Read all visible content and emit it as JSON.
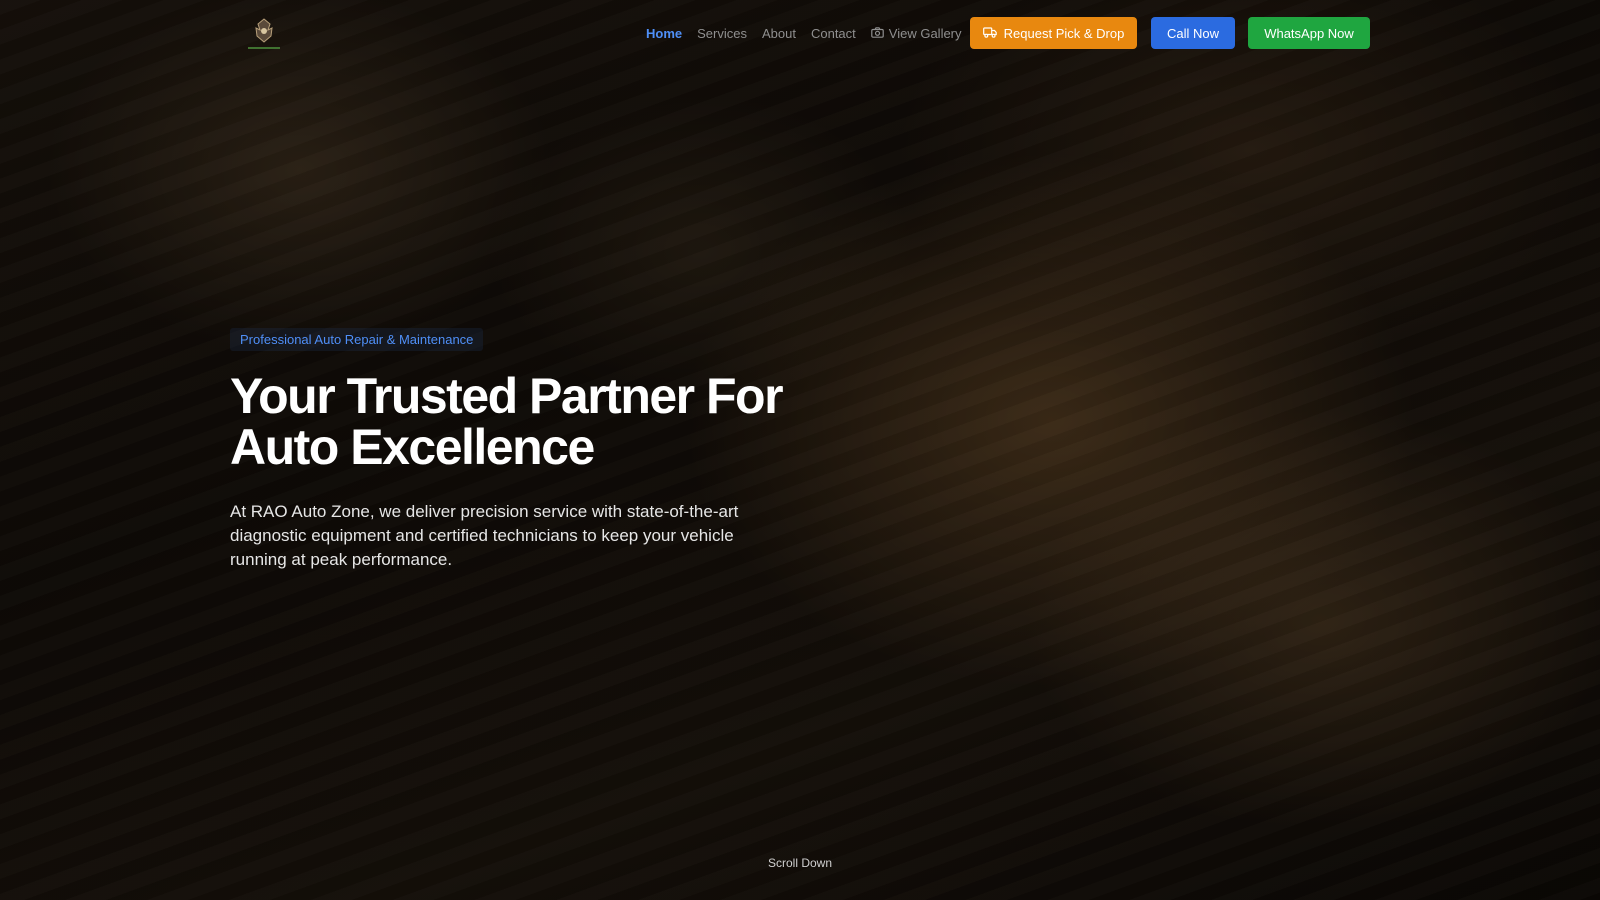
{
  "brand": {
    "logo_icon": "crest-logo-icon"
  },
  "nav": {
    "items": [
      {
        "label": "Home",
        "active": true
      },
      {
        "label": "Services",
        "active": false
      },
      {
        "label": "About",
        "active": false
      },
      {
        "label": "Contact",
        "active": false
      },
      {
        "label": "View Gallery",
        "active": false,
        "icon": "camera-icon"
      }
    ]
  },
  "actions": {
    "pickup": {
      "label": "Request Pick & Drop",
      "icon": "truck-icon",
      "color": "#e8880f"
    },
    "call": {
      "label": "Call Now",
      "color": "#2b6be0"
    },
    "whatsapp": {
      "label": "WhatsApp Now",
      "color": "#1fa640"
    }
  },
  "hero": {
    "tagline": "Professional Auto Repair & Maintenance",
    "title_line1": "Your Trusted Partner For",
    "title_line2": "Auto Excellence",
    "description": "At RAO Auto Zone, we deliver precision service with state-of-the-art diagnostic equipment and certified technicians to keep your vehicle running at peak performance."
  },
  "scroll": {
    "label": "Scroll Down"
  },
  "colors": {
    "accent": "#4f8ff7"
  }
}
